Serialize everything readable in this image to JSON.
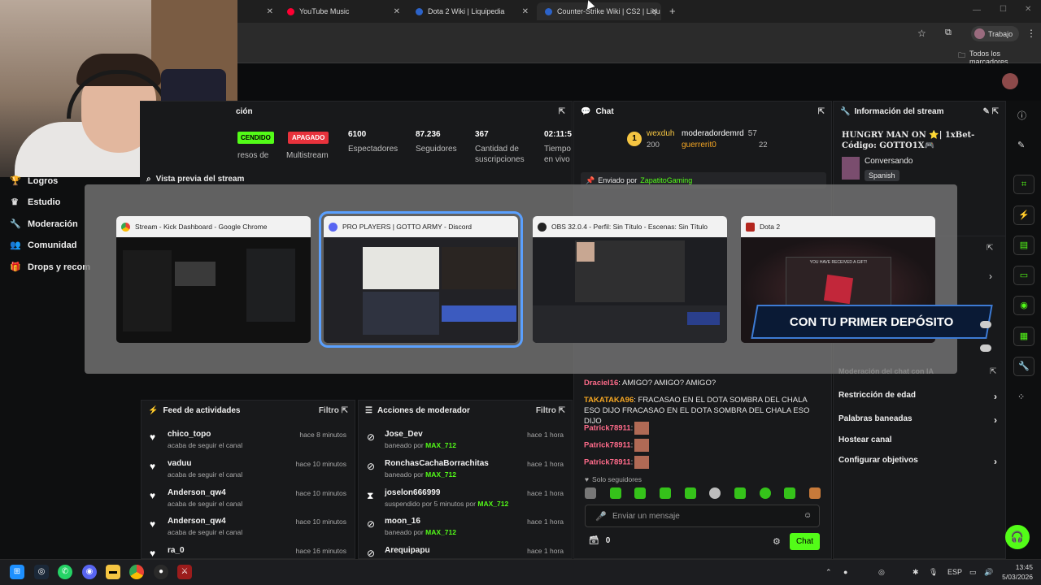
{
  "browser": {
    "tabs": [
      {
        "label": "YouTube Music",
        "color": "#ff0033"
      },
      {
        "label": "Dota 2 Wiki | Liquipedia",
        "color": "#2c63c9"
      },
      {
        "label": "Counter-Strike Wiki | CS2 | Liqu",
        "color": "#2c63c9"
      }
    ],
    "profile_label": "Trabajo",
    "bookmarks_folder": "Todos los marcadores"
  },
  "sidebar": {
    "items": [
      {
        "label": "Logros",
        "icon": "trophy-icon"
      },
      {
        "label": "Estudio",
        "icon": "studio-icon"
      },
      {
        "label": "Moderación",
        "icon": "wrench-icon"
      },
      {
        "label": "Comunidad",
        "icon": "people-icon"
      },
      {
        "label": "Drops y recom",
        "icon": "gift-icon"
      }
    ]
  },
  "session": {
    "title_partial": "ción",
    "badge_live": "CENDIDO",
    "badge_off": "APAGADO",
    "row2_partial": "resos de",
    "multistream_label": "Multistream",
    "stats": [
      {
        "value": "6100",
        "label": "Espectadores"
      },
      {
        "value": "87.236",
        "label": "Seguidores"
      },
      {
        "value": "367",
        "label": "Cantidad de suscripciones"
      },
      {
        "value": "02:11:5",
        "label": "Tiempo en vivo"
      }
    ],
    "preview_label": "Vista previa del stream"
  },
  "chat": {
    "title": "Chat",
    "leaders": [
      {
        "name": "wexduh",
        "count": "200"
      },
      {
        "name": "moderadordemrd",
        "count": "57"
      },
      {
        "name": "guerrerit0",
        "count": "22"
      }
    ],
    "pinned_prefix": "Enviado por",
    "pinned_user": "ZapatitoGaming",
    "messages": [
      {
        "user": "Draciel16",
        "text": "AMIGO? AMIGO? AMIGO?"
      },
      {
        "user": "TAKATAKA96",
        "text": "FRACASAO EN EL DOTA SOMBRA DEL CHALA ESO DIJO FRACASAO EN EL DOTA SOMBRA DEL CHALA ESO DIJO"
      },
      {
        "user": "Patrick78911",
        "text": ""
      },
      {
        "user": "Patrick78911",
        "text": ""
      },
      {
        "user": "Patrick78911",
        "text": ""
      }
    ],
    "followers_only": "Solo seguidores",
    "input_placeholder": "Enviar un mensaje",
    "points": "0",
    "send_label": "Chat"
  },
  "stream_info": {
    "title": "Información del stream",
    "stream_title": "HUNGRY MAN ON ⭐| 1xBet- Código: GOTTO1X🎮",
    "category": "Conversando",
    "language": "Spanish",
    "mod_chat_partial": "Moderación del chat con IA",
    "links": [
      "Restricción de edad",
      "Palabras baneadas",
      "Hostear canal",
      "Configurar objetivos"
    ]
  },
  "activity_feed": {
    "title": "Feed de actividades",
    "filter_label": "Filtro",
    "rows": [
      {
        "name": "chico_topo",
        "sub": "acaba de seguir el canal",
        "time": "hace 8 minutos"
      },
      {
        "name": "vaduu",
        "sub": "acaba de seguir el canal",
        "time": "hace 10 minutos"
      },
      {
        "name": "Anderson_qw4",
        "sub": "acaba de seguir el canal",
        "time": "hace 10 minutos"
      },
      {
        "name": "Anderson_qw4",
        "sub": "acaba de seguir el canal",
        "time": "hace 10 minutos"
      },
      {
        "name": "ra_0",
        "sub": "",
        "time": "hace 16 minutos"
      }
    ]
  },
  "mod_actions": {
    "title": "Acciones de moderador",
    "filter_label": "Filtro",
    "rows": [
      {
        "name": "Jose_Dev",
        "action": "baneado por",
        "mod": "MAX_712",
        "time": "hace 1 hora"
      },
      {
        "name": "RonchasCachaBorrachitas",
        "action": "baneado por",
        "mod": "MAX_712",
        "time": "hace 1 hora"
      },
      {
        "name": "joselon666999",
        "action": "suspendido por 5 minutos por",
        "mod": "MAX_712",
        "time": "hace 1 hora"
      },
      {
        "name": "moon_16",
        "action": "baneado por",
        "mod": "MAX_712",
        "time": "hace 1 hora"
      },
      {
        "name": "Arequipapu",
        "action": "",
        "mod": "",
        "time": "hace 1 hora"
      }
    ]
  },
  "switcher": {
    "windows": [
      {
        "title": "Stream - Kick Dashboard - Google Chrome",
        "icon": "chrome-icon"
      },
      {
        "title": "PRO PLAYERS | GOTTO ARMY - Discord",
        "icon": "discord-icon"
      },
      {
        "title": "OBS 32.0.4 - Perfil: Sin Título - Escenas: Sin Título",
        "icon": "obs-icon"
      },
      {
        "title": "Dota 2",
        "icon": "dota-icon"
      }
    ],
    "dota_gift_text": "YOU HAVE RECEIVED A GIFT!"
  },
  "banner_text": "CON TU PRIMER DEPÓSITO",
  "taskbar": {
    "lang": "ESP",
    "time": "13:45",
    "date": "5/03/2026"
  }
}
